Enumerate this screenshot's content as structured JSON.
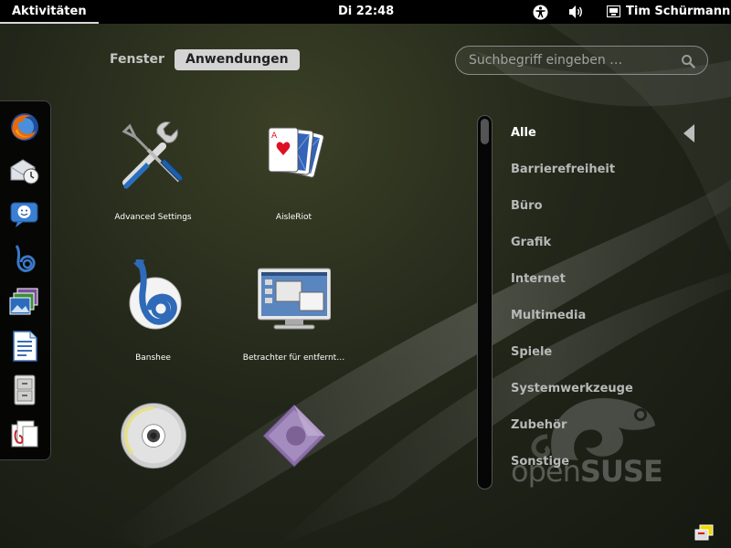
{
  "top_panel": {
    "activities_label": "Aktivitäten",
    "clock": "Di 22:48",
    "user_name": "Tim Schürmann",
    "icons": [
      "accessibility-icon",
      "volume-icon",
      "user-icon"
    ]
  },
  "view_selector": {
    "windows_label": "Fenster",
    "applications_label": "Anwendungen",
    "selected": "Anwendungen"
  },
  "search": {
    "placeholder": "Suchbegriff eingeben …",
    "value": ""
  },
  "dash": {
    "items": [
      {
        "name": "firefox-icon"
      },
      {
        "name": "evolution-icon"
      },
      {
        "name": "empathy-icon"
      },
      {
        "name": "banshee-icon"
      },
      {
        "name": "shotwell-icon"
      },
      {
        "name": "libreoffice-writer-icon"
      },
      {
        "name": "file-manager-icon"
      },
      {
        "name": "documents-icon"
      }
    ]
  },
  "apps": [
    {
      "label": "Advanced Settings",
      "icon": "advanced-settings-icon"
    },
    {
      "label": "AisleRiot",
      "icon": "aisleriot-icon"
    },
    {
      "label": "Banshee",
      "icon": "banshee-icon"
    },
    {
      "label": "Betrachter für entfernt…",
      "icon": "remote-viewer-icon"
    },
    {
      "label": "",
      "icon": "brasero-icon"
    },
    {
      "label": "",
      "icon": "inkscape-icon"
    }
  ],
  "categories": {
    "selected": "Alle",
    "items": [
      "Alle",
      "Barrierefreiheit",
      "Büro",
      "Grafik",
      "Internet",
      "Multimedia",
      "Spiele",
      "Systemwerkzeuge",
      "Zubehör",
      "Sonstige"
    ]
  },
  "watermark": {
    "brand_light": "open",
    "brand_bold": "SUSE"
  },
  "colors": {
    "panel_bg": "#000000",
    "selected_tab_bg": "#d4d4d4",
    "category_text": "#b8b8b8"
  }
}
